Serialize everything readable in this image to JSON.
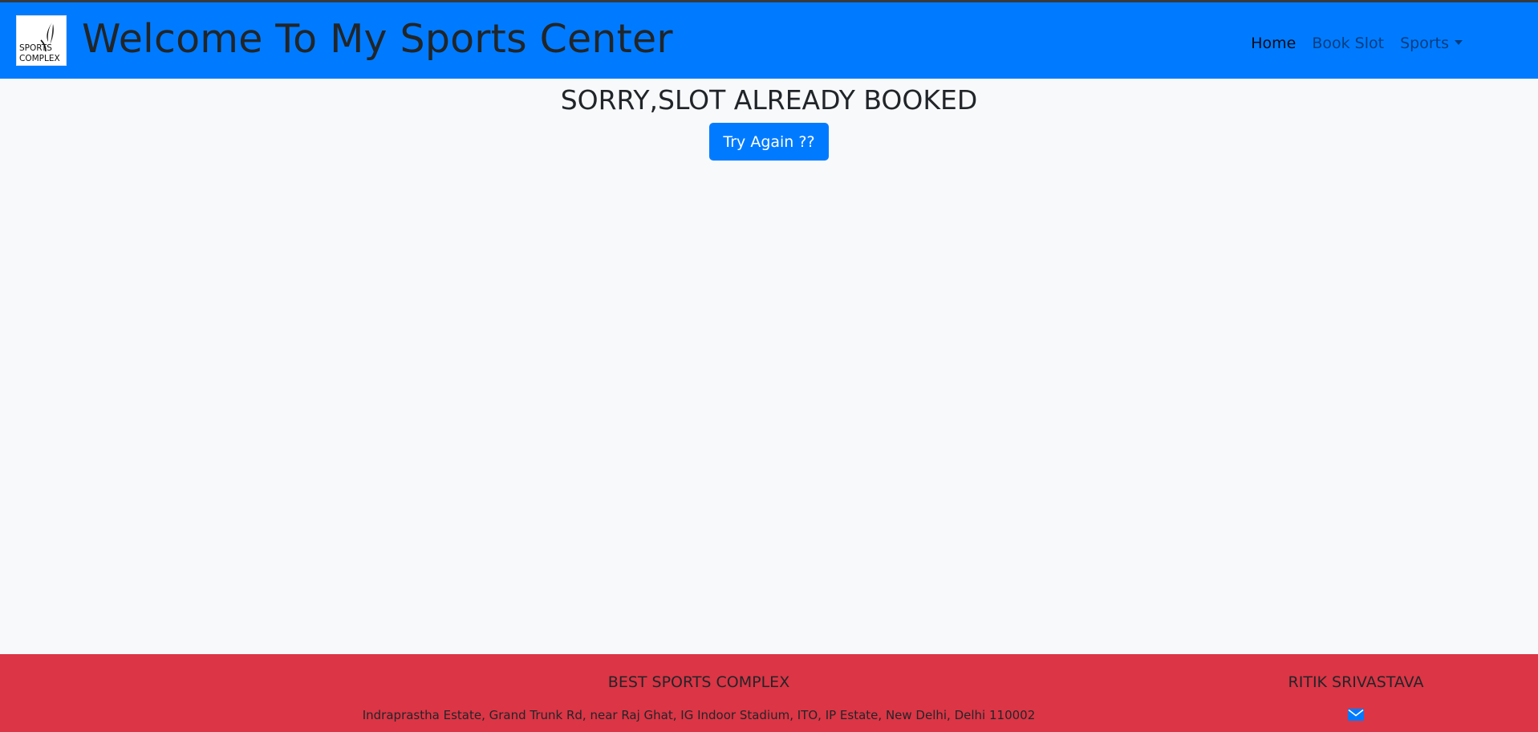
{
  "navbar": {
    "logo_text_line1": "SPORTS",
    "logo_text_line2": "COMPLEX",
    "title": "Welcome To My Sports Center",
    "links": [
      {
        "label": "Home",
        "active": true
      },
      {
        "label": "Book Slot",
        "active": false
      },
      {
        "label": "Sports",
        "active": false,
        "dropdown": true
      }
    ]
  },
  "main": {
    "message": "SORRY,SLOT ALREADY BOOKED",
    "button_label": "Try Again ??"
  },
  "footer": {
    "company": "BEST SPORTS COMPLEX",
    "address": "Indraprastha Estate, Grand Trunk Rd, near Raj Ghat, IG Indoor Stadium, ITO, IP Estate, New Delhi, Delhi 110002",
    "owner": "RITIK SRIVASTAVA",
    "contact_icon": "envelope-icon"
  },
  "colors": {
    "navbar_bg": "#007bff",
    "footer_bg": "#dc3545",
    "button_bg": "#007bff",
    "page_bg": "#f8f9fa"
  }
}
